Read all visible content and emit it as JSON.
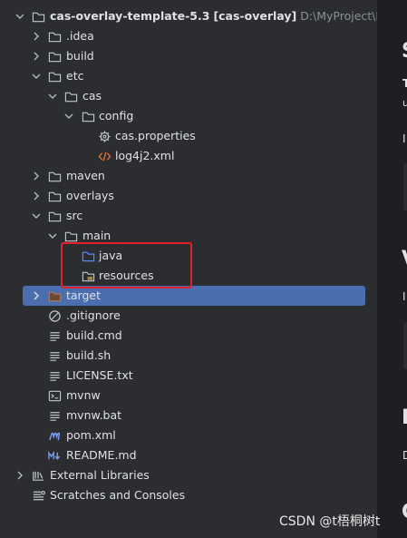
{
  "project": {
    "root_name": "cas-overlay-template-5.3",
    "module": "[cas-overlay]",
    "path": "D:\\MyProject\\MyC"
  },
  "tree": {
    "idea": ".idea",
    "build": "build",
    "etc": "etc",
    "cas": "cas",
    "config": "config",
    "cas_properties": "cas.properties",
    "log4j2": "log4j2.xml",
    "maven": "maven",
    "overlays": "overlays",
    "src": "src",
    "main": "main",
    "java": "java",
    "resources": "resources",
    "target": "target",
    "gitignore": ".gitignore",
    "build_cmd": "build.cmd",
    "build_sh": "build.sh",
    "license": "LICENSE.txt",
    "mvnw": "mvnw",
    "mvnw_bat": "mvnw.bat",
    "pom": "pom.xml",
    "readme": "README.md",
    "external_libraries": "External Libraries",
    "scratches": "Scratches and Consoles"
  },
  "right_panel": {
    "p1": "S",
    "p2": "T",
    "p3": "u",
    "p4": "I",
    "p5": "V",
    "p6": "I",
    "p7": "I",
    "p8": "D",
    "p9": "C"
  },
  "watermark": "CSDN @t梧桐树t",
  "colors": {
    "selection": "#4b6eaf",
    "highlight_box": "#e5202b",
    "folder": "#c4c7cc",
    "source_folder": "#548af7",
    "resources_folder": "#e3b341",
    "xml": "#e27a3f"
  }
}
